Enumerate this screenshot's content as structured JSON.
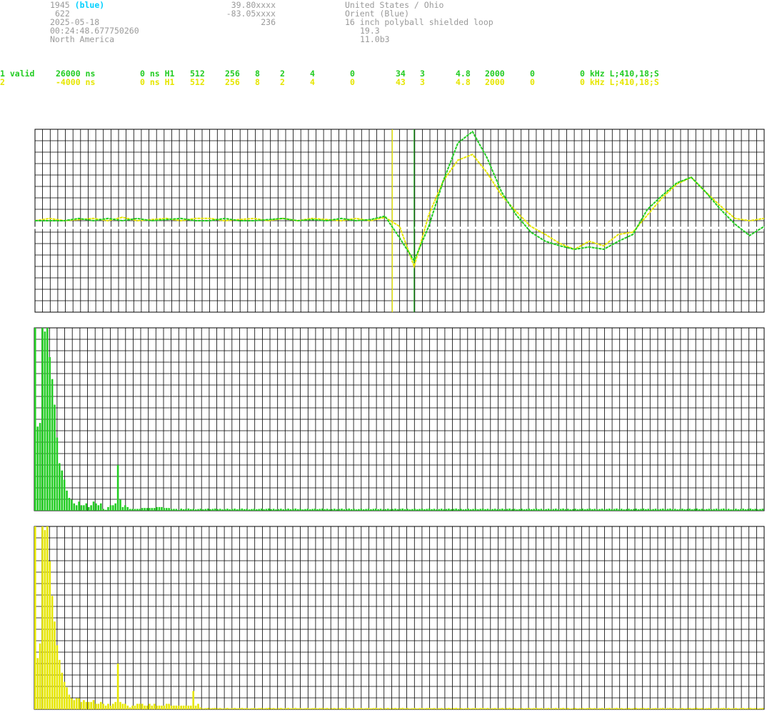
{
  "header": {
    "station_id": "1945",
    "station_color": "(blue)",
    "code": "622",
    "date": "2025-05-18",
    "time": "00:24:48.677750260",
    "continent": "North America",
    "lat": "39.80xxxx",
    "lon": "-83.05xxxx",
    "alt": "236",
    "country": "United States / Ohio",
    "orient": "Orient (Blue)",
    "antenna": "16 inch polyball shielded loop",
    "val1": "19.3",
    "val2": "11.0b3"
  },
  "channels": [
    {
      "c1": "1 valid",
      "c2": "26000 ns",
      "c3": "0 ns H1",
      "c4": "512",
      "c5": "256",
      "c6": "8",
      "c7": "2",
      "c8": "4",
      "c9": "0",
      "c10": "34",
      "c11": "3",
      "c12": "4.8",
      "c13": "2000",
      "c14": "0",
      "c15": "0 kHz L;410,18;S",
      "color": "#22cc22"
    },
    {
      "c1": "2",
      "c2": "-4000 ns",
      "c3": "0 ns H1",
      "c4": "512",
      "c5": "256",
      "c6": "8",
      "c7": "2",
      "c8": "4",
      "c9": "0",
      "c10": "43",
      "c11": "3",
      "c12": "4.8",
      "c13": "2000",
      "c14": "0",
      "c15": "0 kHz L;410,18;S",
      "color": "#e6e600"
    }
  ],
  "chart_data": [
    {
      "type": "line",
      "x": [
        0,
        2,
        4,
        6,
        8,
        10,
        12,
        14,
        16,
        18,
        20,
        22,
        24,
        26,
        28,
        30,
        32,
        34,
        36,
        38,
        40,
        42,
        44,
        46,
        48,
        50,
        52,
        54,
        56,
        58,
        60,
        62,
        64,
        66,
        68,
        70,
        72,
        74,
        76,
        78,
        80,
        82,
        84,
        86,
        88,
        90,
        92,
        94,
        96,
        98,
        100
      ],
      "series": [
        {
          "color": "#22cc22",
          "values": [
            0,
            0,
            0,
            0.2,
            0,
            0.2,
            0,
            0.2,
            0,
            0.1,
            0.2,
            0,
            0,
            0.2,
            0,
            0,
            0.1,
            0.2,
            0,
            0.1,
            0,
            0.2,
            0,
            0.1,
            0.4,
            -1.5,
            -3.5,
            -0.5,
            3.5,
            6.8,
            7.8,
            5.5,
            2.5,
            0.5,
            -1,
            -1.8,
            -2.2,
            -2.5,
            -2.3,
            -2.5,
            -1.8,
            -1.2,
            1,
            2.2,
            3.3,
            3.8,
            2.5,
            1,
            -0.3,
            -1.3,
            -0.5
          ]
        },
        {
          "color": "#e6e600",
          "values": [
            0,
            0.2,
            0,
            0.1,
            0.2,
            0,
            0.3,
            0,
            0.1,
            0.2,
            0,
            0.2,
            0.2,
            0,
            0.1,
            0.2,
            0,
            0.2,
            0,
            0.2,
            0.1,
            0,
            0.2,
            0,
            0.3,
            -0.5,
            -4,
            0.5,
            3.5,
            5.3,
            5.8,
            4.2,
            2.2,
            0.8,
            -0.5,
            -1.2,
            -2,
            -2.5,
            -1.8,
            -2.2,
            -1.2,
            -1,
            0.5,
            2,
            3.2,
            3.8,
            2.5,
            1.3,
            0.2,
            0,
            0.2
          ]
        }
      ],
      "markers": [
        {
          "x": 49,
          "color": "#e6e600"
        },
        {
          "x": 52,
          "color": "#22aa22"
        }
      ],
      "ylim": [
        -8,
        8
      ]
    },
    {
      "type": "bar",
      "color": "#22cc22",
      "values": [
        100,
        46,
        48,
        100,
        98,
        100,
        84,
        72,
        58,
        40,
        26,
        22,
        17,
        11,
        7,
        6,
        4,
        3,
        5,
        3,
        3,
        4,
        2,
        3,
        5,
        4,
        3,
        4,
        1,
        0.5,
        2,
        3,
        3,
        4,
        25,
        6,
        2,
        3,
        2,
        1,
        1,
        1,
        1,
        1,
        1.5,
        1.5,
        1.5,
        1.5,
        1.5,
        1.5,
        2,
        2,
        2,
        1.5,
        1.5,
        1.5,
        1,
        1,
        1,
        0.5
      ],
      "tail_level": 1.2,
      "ylim": [
        0,
        100
      ]
    },
    {
      "type": "bar",
      "color": "#e6e600",
      "values": [
        100,
        28,
        36,
        100,
        98,
        100,
        81,
        62,
        48,
        35,
        27,
        20,
        15,
        12,
        8,
        6,
        5,
        6,
        6,
        4,
        5,
        4,
        4,
        4,
        5,
        3,
        3,
        4,
        3,
        2,
        3,
        2,
        3,
        4,
        25,
        4,
        3,
        3,
        2,
        1,
        2,
        2,
        3,
        3,
        3,
        2,
        2,
        3,
        2,
        3,
        2,
        2,
        2,
        2,
        3,
        3,
        2,
        2,
        2,
        2,
        2,
        2,
        2,
        2,
        2,
        10,
        2,
        3,
        1
      ],
      "tail_level": 0.8,
      "ylim": [
        0,
        100
      ]
    }
  ]
}
